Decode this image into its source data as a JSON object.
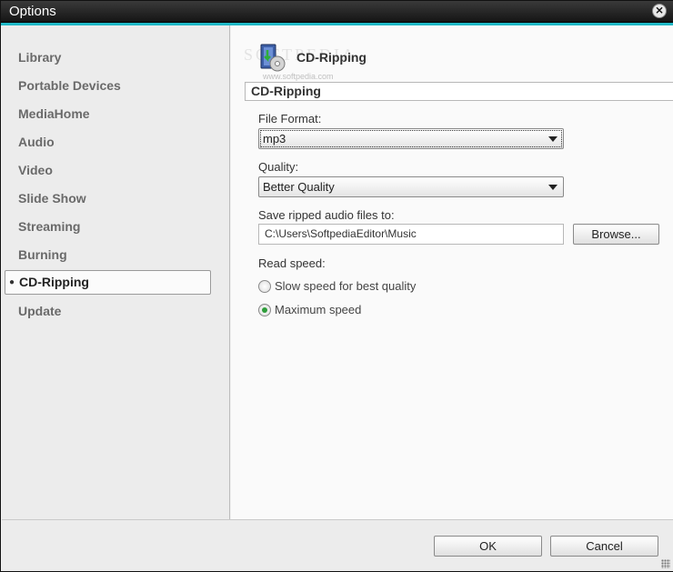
{
  "window": {
    "title": "Options",
    "close_glyph": "⨯"
  },
  "colors": {
    "accent": "#1fb8c6",
    "radio_checked": "#2e9d3a"
  },
  "sidebar": {
    "items": [
      {
        "label": "Library"
      },
      {
        "label": "Portable Devices"
      },
      {
        "label": "MediaHome"
      },
      {
        "label": "Audio"
      },
      {
        "label": "Video"
      },
      {
        "label": "Slide Show"
      },
      {
        "label": "Streaming"
      },
      {
        "label": "Burning"
      },
      {
        "label": "CD-Ripping",
        "selected": true
      },
      {
        "label": "Update"
      }
    ]
  },
  "content": {
    "header_title": "CD-Ripping",
    "header_icon": "cd-ripping-icon",
    "section_title": "CD-Ripping",
    "watermark": "SOFTPEDIA",
    "watermark_url": "www.softpedia.com",
    "file_format": {
      "label": "File Format:",
      "value": "mp3"
    },
    "quality": {
      "label": "Quality:",
      "value": "Better Quality"
    },
    "save_path": {
      "label": "Save ripped audio files to:",
      "value": "C:\\Users\\SoftpediaEditor\\Music",
      "browse_label": "Browse..."
    },
    "read_speed": {
      "label": "Read speed:",
      "options": [
        {
          "label": "Slow speed for best quality",
          "checked": false
        },
        {
          "label": "Maximum speed",
          "checked": true
        }
      ]
    }
  },
  "footer": {
    "ok_label": "OK",
    "cancel_label": "Cancel"
  }
}
